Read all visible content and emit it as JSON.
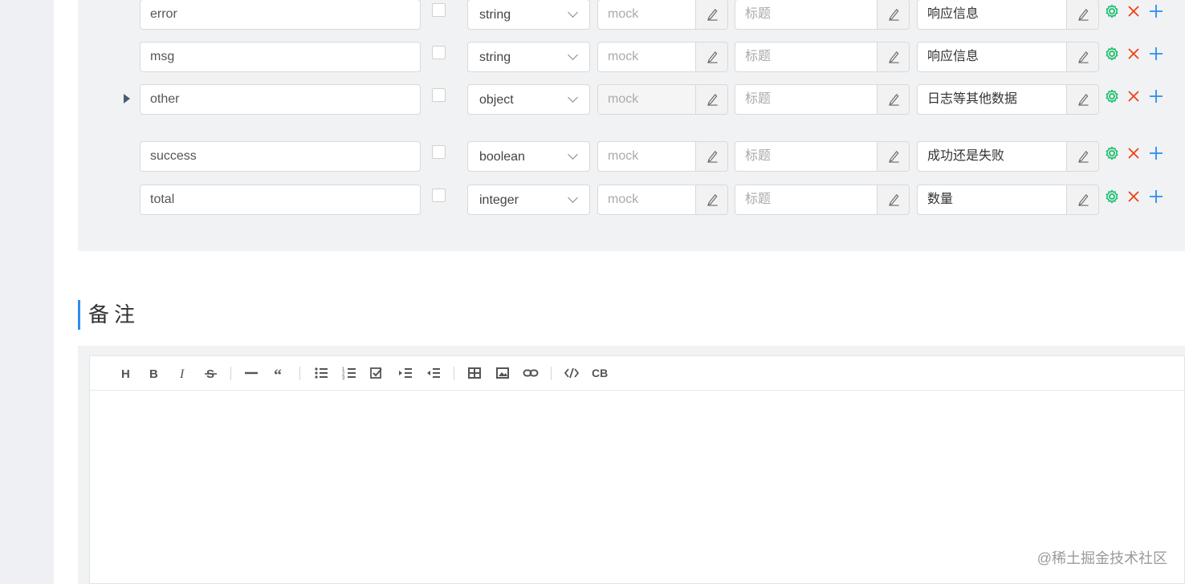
{
  "schema_rows": [
    {
      "name": "error",
      "type": "string",
      "mock_placeholder": "mock",
      "title_placeholder": "标题",
      "description": "响应信息",
      "expandable": false,
      "mock_disabled": false
    },
    {
      "name": "msg",
      "type": "string",
      "mock_placeholder": "mock",
      "title_placeholder": "标题",
      "description": "响应信息",
      "expandable": false,
      "mock_disabled": false
    },
    {
      "name": "other",
      "type": "object",
      "mock_placeholder": "mock",
      "title_placeholder": "标题",
      "description": "日志等其他数据",
      "expandable": true,
      "mock_disabled": true
    },
    {
      "name": "success",
      "type": "boolean",
      "mock_placeholder": "mock",
      "title_placeholder": "标题",
      "description": "成功还是失败",
      "expandable": false,
      "mock_disabled": false
    },
    {
      "name": "total",
      "type": "integer",
      "mock_placeholder": "mock",
      "title_placeholder": "标题",
      "description": "数量",
      "expandable": false,
      "mock_disabled": false
    }
  ],
  "notes_section": {
    "title": "备注"
  },
  "editor_toolbar": [
    {
      "icon": "heading-icon"
    },
    {
      "icon": "bold-icon"
    },
    {
      "icon": "italic-icon"
    },
    {
      "icon": "strikethrough-icon"
    },
    {
      "sep": true
    },
    {
      "icon": "horizontal-rule-icon"
    },
    {
      "icon": "quote-icon"
    },
    {
      "sep": true
    },
    {
      "icon": "unordered-list-icon"
    },
    {
      "icon": "ordered-list-icon"
    },
    {
      "icon": "task-list-icon"
    },
    {
      "icon": "indent-icon"
    },
    {
      "icon": "outdent-icon"
    },
    {
      "sep": true
    },
    {
      "icon": "table-icon"
    },
    {
      "icon": "image-icon"
    },
    {
      "icon": "link-icon"
    },
    {
      "sep": true
    },
    {
      "icon": "code-icon"
    },
    {
      "icon": "code-block-icon",
      "label": "CB"
    }
  ],
  "watermark": "@稀土掘金技术社区",
  "colors": {
    "accent": "#2d8cf0",
    "settings": "#19be6b",
    "delete": "#ed4014",
    "add": "#2d8cf0"
  }
}
